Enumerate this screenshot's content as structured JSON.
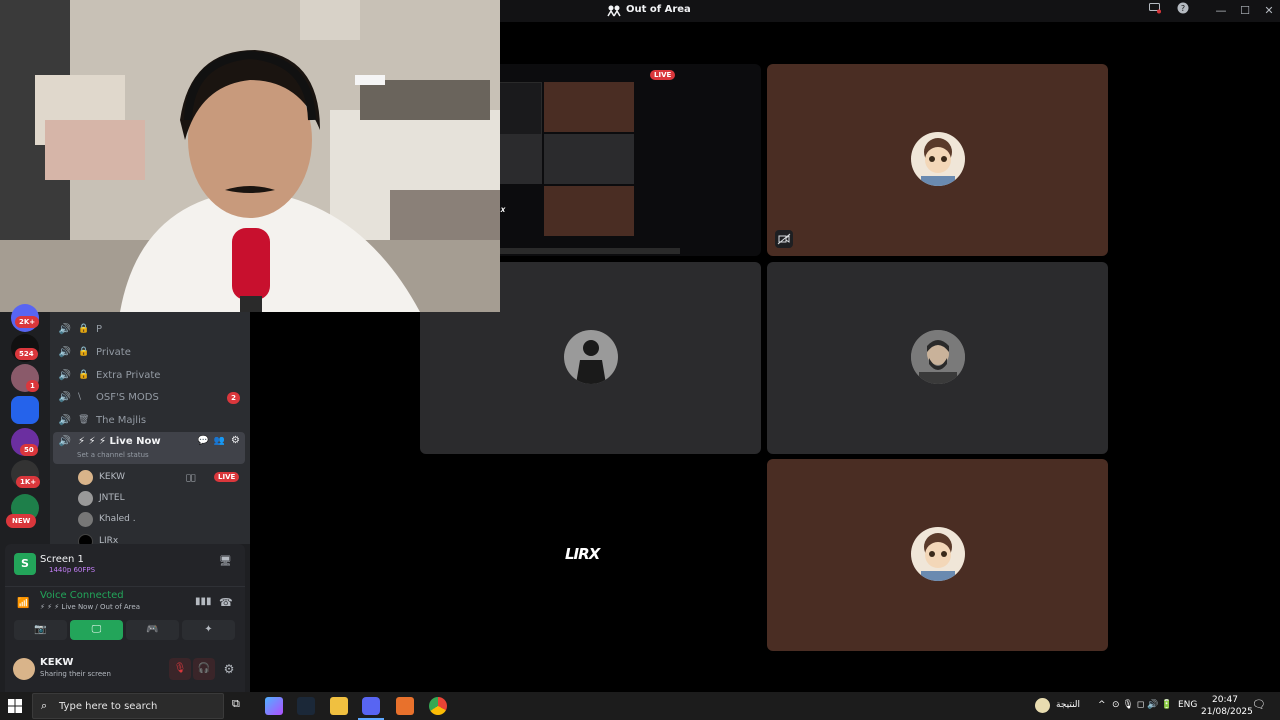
{
  "window": {
    "title": "Out of Area"
  },
  "stream_thumb": {
    "live_label": "LIVE",
    "inner_label": "LIRX"
  },
  "grid": {
    "lirx_label": "LIRX"
  },
  "servers": [
    {
      "badge": "2K+"
    },
    {
      "badge": "524"
    },
    {
      "badge": "1"
    },
    {
      "badge": ""
    },
    {
      "badge": "50"
    },
    {
      "badge": "1K+"
    },
    {
      "badge": "NEW"
    }
  ],
  "channels": [
    {
      "name": "P"
    },
    {
      "name": "Private"
    },
    {
      "name": "Extra Private"
    },
    {
      "name": "OSF'S MODS",
      "badge": "2"
    },
    {
      "name": "The Majlis"
    }
  ],
  "active_channel": {
    "name": "⚡ ⚡ ⚡ Live Now",
    "status": "Set a channel status"
  },
  "voice_users": [
    {
      "name": "KEKW",
      "live": "LIVE"
    },
    {
      "name": "JNTEL"
    },
    {
      "name": "Khaled ."
    },
    {
      "name": "LIRx"
    }
  ],
  "screen_share": {
    "title": "Screen 1",
    "quality": "1440p 60FPS"
  },
  "voice": {
    "status": "Voice Connected",
    "location": "⚡ ⚡ ⚡ Live Now / Out of Area"
  },
  "user": {
    "name": "KEKW",
    "status": "Sharing their screen"
  },
  "taskbar": {
    "search_placeholder": "Type here to search",
    "weather_label": "النتيجة",
    "lang": "ENG",
    "time": "20:47",
    "date": "21/08/2025"
  },
  "colors": {
    "accent_green": "#23a55a",
    "live_red": "#da373c",
    "tile_brown": "#4a2d23",
    "tile_gray": "#2b2b2d"
  }
}
